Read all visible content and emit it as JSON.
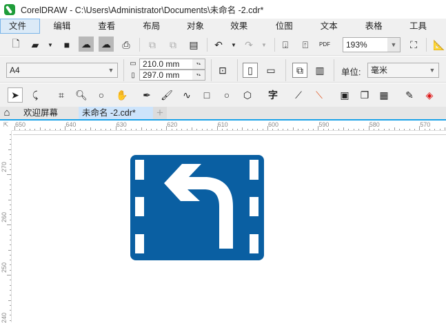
{
  "title": "CorelDRAW - C:\\Users\\Administrator\\Documents\\未命名 -2.cdr*",
  "menu": [
    "文件(F)",
    "编辑(E)",
    "查看(V)",
    "布局(L)",
    "对象(J)",
    "效果(C)",
    "位图(B)",
    "文本(X)",
    "表格(T)",
    "工具(O)"
  ],
  "toolbar": {
    "zoom": "193%",
    "pdf": "PDF"
  },
  "property": {
    "page_size": "A4",
    "width": "210.0 mm",
    "height": "297.0 mm",
    "unit_label": "单位:",
    "unit": "毫米"
  },
  "tabs": {
    "welcome": "欢迎屏幕",
    "document": "未命名 -2.cdr*",
    "add": "+"
  },
  "hruler": [
    "650",
    "640",
    "630",
    "620",
    "610",
    "600",
    "590",
    "580",
    "570"
  ],
  "vruler": [
    "270",
    "260",
    "250",
    "240"
  ],
  "colors": {
    "sign": "#0a5fa2",
    "accent": "#1aa3e8"
  }
}
